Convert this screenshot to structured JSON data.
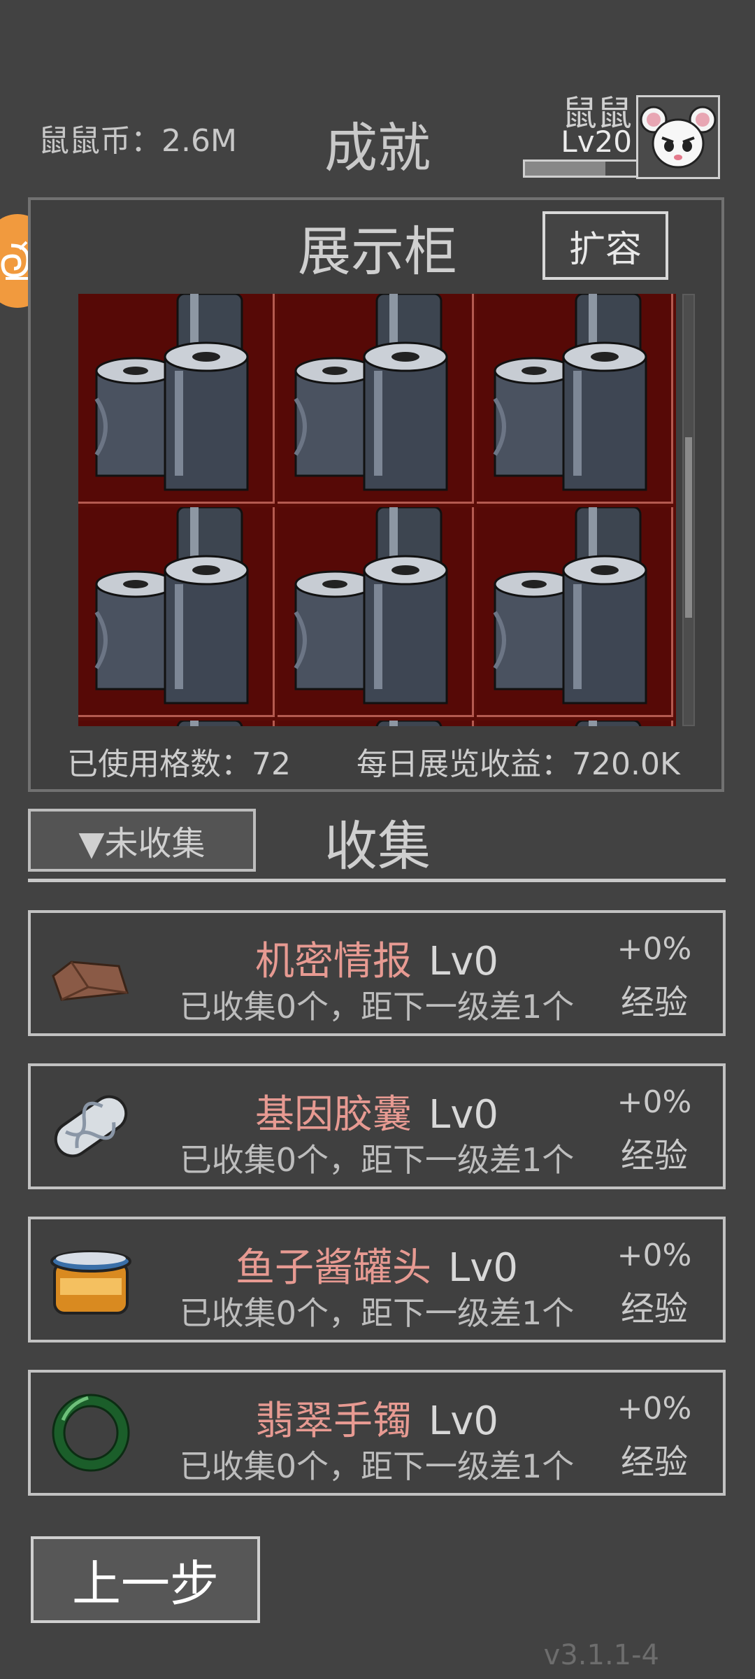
{
  "header": {
    "coin_text": "鼠鼠币：2.6M",
    "title": "成就",
    "player_name": "鼠鼠",
    "player_level": "Lv20",
    "xp_progress": 0.72
  },
  "cabinet": {
    "title": "展示柜",
    "expand_label": "扩容",
    "used_slots_text": "已使用格数：72",
    "daily_income_text": "每日展览收益：720.0K",
    "cell_color": "#560906",
    "scroll_position": 0.57,
    "scroll_visible_fraction": 0.42
  },
  "collect": {
    "filter_label": "▼未收集",
    "title": "收集",
    "items": [
      {
        "name": "机密情报",
        "level": "Lv0",
        "desc": "已收集0个，距下一级差1个",
        "bonus": "+0%",
        "bonus_label": "经验",
        "icon": "document-folder-icon"
      },
      {
        "name": "基因胶囊",
        "level": "Lv0",
        "desc": "已收集0个，距下一级差1个",
        "bonus": "+0%",
        "bonus_label": "经验",
        "icon": "dna-capsule-icon"
      },
      {
        "name": "鱼子酱罐头",
        "level": "Lv0",
        "desc": "已收集0个，距下一级差1个",
        "bonus": "+0%",
        "bonus_label": "经验",
        "icon": "caviar-jar-icon"
      },
      {
        "name": "翡翠手镯",
        "level": "Lv0",
        "desc": "已收集0个，距下一级差1个",
        "bonus": "+0%",
        "bonus_label": "经验",
        "icon": "jade-bracelet-icon"
      }
    ]
  },
  "footer": {
    "back_label": "上一步",
    "version": "v3.1.1-4"
  }
}
